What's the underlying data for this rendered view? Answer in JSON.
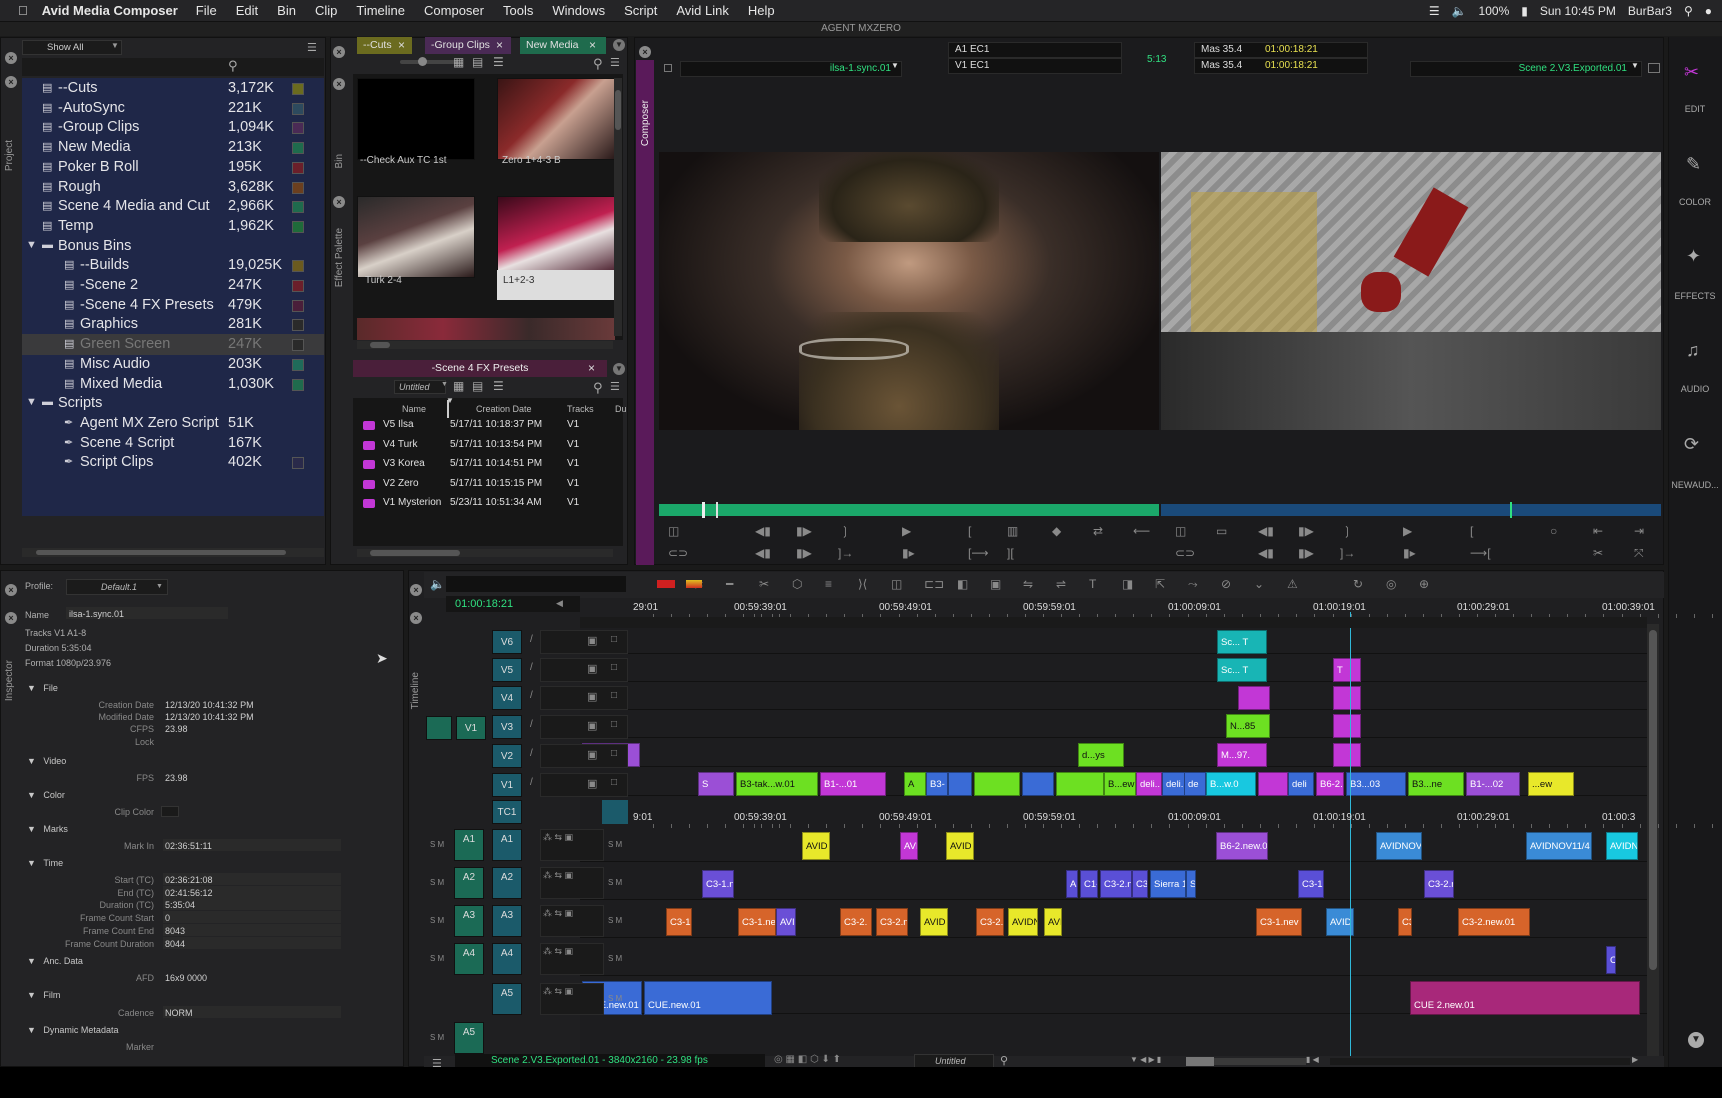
{
  "menubar": {
    "app_name": "Avid Media Composer",
    "items": [
      "File",
      "Edit",
      "Bin",
      "Clip",
      "Timeline",
      "Composer",
      "Tools",
      "Windows",
      "Script",
      "Avid Link",
      "Help"
    ],
    "battery": "100%",
    "clock": "Sun 10:45 PM",
    "user": "BurBar3"
  },
  "window_title": "AGENT MXZERO",
  "project": {
    "filter": "Show All",
    "bins": [
      {
        "name": "--Cuts",
        "size": "3,172K",
        "color": "#6b6b1f",
        "indent": 0,
        "icon": "bin-icon"
      },
      {
        "name": "-AutoSync",
        "size": "221K",
        "color": "#2d4a5e",
        "indent": 0,
        "icon": "bin-icon"
      },
      {
        "name": "-Group Clips",
        "size": "1,094K",
        "color": "#4a2a55",
        "indent": 0,
        "icon": "bin-icon"
      },
      {
        "name": "New Media",
        "size": "213K",
        "color": "#1f6b4d",
        "indent": 0,
        "icon": "bin-icon"
      },
      {
        "name": "Poker B Roll",
        "size": "195K",
        "color": "#6b1f2a",
        "indent": 0,
        "icon": "bin-icon"
      },
      {
        "name": "Rough",
        "size": "3,628K",
        "color": "#6b3f1f",
        "indent": 0,
        "icon": "bin-icon"
      },
      {
        "name": "Scene 4 Media and Cut",
        "size": "2,966K",
        "color": "#1f6b4d",
        "indent": 0,
        "icon": "bin-icon"
      },
      {
        "name": "Temp",
        "size": "1,962K",
        "color": "#1f6b3a",
        "indent": 0,
        "icon": "bin-icon"
      },
      {
        "name": "Bonus Bins",
        "size": "",
        "color": "",
        "indent": 0,
        "icon": "folder-icon",
        "expander": "▼"
      },
      {
        "name": "--Builds",
        "size": "19,025K",
        "color": "#6b5a1f",
        "indent": 1,
        "icon": "bin-icon"
      },
      {
        "name": "-Scene 2",
        "size": "247K",
        "color": "#6b1f2a",
        "indent": 1,
        "icon": "bin-icon"
      },
      {
        "name": "-Scene 4 FX Presets",
        "size": "479K",
        "color": "#4a1f3a",
        "indent": 1,
        "icon": "bin-icon"
      },
      {
        "name": "Graphics",
        "size": "281K",
        "color": "#2a2a2a",
        "indent": 1,
        "icon": "bin-icon"
      },
      {
        "name": "Green Screen",
        "size": "247K",
        "color": "#2a2a2a",
        "indent": 1,
        "icon": "bin-icon",
        "selected": true
      },
      {
        "name": "Misc Audio",
        "size": "203K",
        "color": "#1f6b5a",
        "indent": 1,
        "icon": "bin-icon"
      },
      {
        "name": "Mixed Media",
        "size": "1,030K",
        "color": "#1f6b4d",
        "indent": 1,
        "icon": "bin-icon"
      },
      {
        "name": "Scripts",
        "size": "",
        "color": "",
        "indent": 0,
        "icon": "folder-icon",
        "expander": "▼"
      },
      {
        "name": "Agent MX Zero Script",
        "size": "51K",
        "color": "",
        "indent": 1,
        "icon": "script-icon"
      },
      {
        "name": "Scene 4 Script",
        "size": "167K",
        "color": "",
        "indent": 1,
        "icon": "script-icon"
      },
      {
        "name": "Script Clips",
        "size": "402K",
        "color": "#2a2a4a",
        "indent": 1,
        "icon": "script-icon"
      }
    ]
  },
  "bin_tabs": [
    "--Cuts",
    "-Group Clips",
    "New Media"
  ],
  "bin_thumbs": [
    {
      "label": "--Check Aux TC 1st"
    },
    {
      "label": "Zero 1+4-3 B"
    },
    {
      "label": "Turk 2-4"
    },
    {
      "label": "L1+2-3"
    }
  ],
  "side_tabs": {
    "bin": "Bin",
    "effect_palette": "Effect Palette",
    "project": "Project",
    "composer": "Composer",
    "inspector": "Inspector",
    "timeline": "Timeline"
  },
  "fx_bin": {
    "title": "-Scene 4 FX Presets",
    "view": "Untitled",
    "columns": [
      "Name",
      "Creation Date",
      "Tracks",
      "Du"
    ],
    "rows": [
      {
        "name": "V5 Ilsa",
        "date": "5/17/11 10:18:37 PM",
        "tracks": "V1"
      },
      {
        "name": "V4 Turk",
        "date": "5/17/11 10:13:54 PM",
        "tracks": "V1"
      },
      {
        "name": "V3 Korea",
        "date": "5/17/11 10:14:51 PM",
        "tracks": "V1"
      },
      {
        "name": "V2 Zero",
        "date": "5/17/11 10:15:15 PM",
        "tracks": "V1"
      },
      {
        "name": "V1 Mysterion",
        "date": "5/23/11 10:51:34 AM",
        "tracks": "V1"
      }
    ]
  },
  "composer": {
    "source_clip": "ilsa-1.sync.01",
    "track_a1": "A1  EC1",
    "track_v1": "V1  EC1",
    "duration": "5:13",
    "mas1": "Mas  35.4",
    "tc1": "01:00:18:21",
    "mas2": "Mas  35.4",
    "tc2": "01:00:18:21",
    "record_sequence": "Scene 2.V3.Exported.01"
  },
  "right_panel": [
    "EDIT",
    "COLOR",
    "EFFECTS",
    "AUDIO",
    "NEWAUD..."
  ],
  "inspector": {
    "profile_label": "Profile:",
    "profile": "Default.1",
    "name_label": "Name",
    "name": "ilsa-1.sync.01",
    "tracks": "Tracks   V1 A1-8",
    "duration": "Duration 5:35:04",
    "format": "Format  1080p/23.976",
    "sections": {
      "file": "File",
      "video": "Video",
      "color": "Color",
      "marks": "Marks",
      "time": "Time",
      "anc": "Anc. Data",
      "film": "Film",
      "dynmeta": "Dynamic Metadata"
    },
    "fields": {
      "creation_date": {
        "label": "Creation Date",
        "value": "12/13/20 10:41:32 PM"
      },
      "modified_date": {
        "label": "Modified Date",
        "value": "12/13/20 10:41:32 PM"
      },
      "cfps": {
        "label": "CFPS",
        "value": "23.98"
      },
      "lock": {
        "label": "Lock",
        "value": ""
      },
      "fps": {
        "label": "FPS",
        "value": "23.98"
      },
      "clip_color": {
        "label": "Clip Color",
        "value": ""
      },
      "mark_in": {
        "label": "Mark In",
        "value": "02:36:51:11"
      },
      "start": {
        "label": "Start (TC)",
        "value": "02:36:21:08"
      },
      "end": {
        "label": "End (TC)",
        "value": "02:41:56:12"
      },
      "duration_tc": {
        "label": "Duration (TC)",
        "value": "5:35:04"
      },
      "fcs": {
        "label": "Frame Count Start",
        "value": "0"
      },
      "fce": {
        "label": "Frame Count End",
        "value": "8043"
      },
      "fcd": {
        "label": "Frame Count Duration",
        "value": "8044"
      },
      "afd": {
        "label": "AFD",
        "value": "16x9 0000"
      },
      "cadence": {
        "label": "Cadence",
        "value": "NORM"
      },
      "marker": {
        "label": "Marker",
        "value": ""
      }
    }
  },
  "timeline": {
    "position": "01:00:18:21",
    "ruler": [
      "29:01",
      "00:59:39:01",
      "00:59:49:01",
      "00:59:59:01",
      "01:00:09:01",
      "01:00:19:01",
      "01:00:29:01",
      "01:00:39:01"
    ],
    "ruler2": [
      "9:01",
      "00:59:39:01",
      "00:59:49:01",
      "00:59:59:01",
      "01:00:09:01",
      "01:00:19:01",
      "01:00:29:01",
      "01:00:3"
    ],
    "video_tracks": [
      "V6",
      "V5",
      "V4",
      "V3",
      "V2",
      "V1"
    ],
    "timecode_track": "TC1",
    "source_v": "V1",
    "audio_tracks": [
      "A1",
      "A2",
      "A3",
      "A4",
      "A5"
    ],
    "source_audio": [
      "A1",
      "A2",
      "A3",
      "A4",
      "A5"
    ],
    "status": "Scene 2.V3.Exported.01 - 3840x2160 - 23.98 fps",
    "view": "Untitled",
    "clips": {
      "v6": [
        {
          "t": "Sc... T",
          "c": "#18b5b5"
        }
      ],
      "v5": [
        {
          "t": "Sc... T",
          "c": "#18b5b5"
        },
        {
          "t": "T",
          "c": "#c237d6"
        }
      ],
      "v4": [
        {
          "t": "",
          "c": "#c237d6"
        },
        {
          "t": "",
          "c": "#c237d6"
        }
      ],
      "v3": [
        {
          "t": "N...85",
          "c": "#6de022"
        },
        {
          "t": "",
          "c": "#c237d6"
        }
      ],
      "v2": [
        {
          "t": "...",
          "c": "#9b4fd6"
        },
        {
          "t": "d...ys",
          "c": "#6de022"
        },
        {
          "t": "M...97.",
          "c": "#c237d6"
        },
        {
          "t": "",
          "c": "#c237d6"
        }
      ],
      "v1": [
        {
          "t": "S",
          "c": "#9b4fd6"
        },
        {
          "t": "B3-tak...w.01",
          "c": "#6de022"
        },
        {
          "t": "B1-...01",
          "c": "#c237d6"
        },
        {
          "t": "A",
          "c": "#6de022"
        },
        {
          "t": "B3-",
          "c": "#3a6bd6"
        },
        {
          "t": "",
          "c": "#3a6bd6"
        },
        {
          "t": "",
          "c": "#6de022"
        },
        {
          "t": "",
          "c": "#3a6bd6"
        },
        {
          "t": "",
          "c": "#6de022"
        },
        {
          "t": "B...ew",
          "c": "#6de022"
        },
        {
          "t": "deli...e",
          "c": "#c237d6"
        },
        {
          "t": "deli...",
          "c": "#3a6bd6"
        },
        {
          "t": "de",
          "c": "#3a6bd6"
        },
        {
          "t": "B...w.0",
          "c": "#18c8e0"
        },
        {
          "t": "",
          "c": "#c237d6"
        },
        {
          "t": "deli",
          "c": "#3a6bd6"
        },
        {
          "t": "B6-2.",
          "c": "#c237d6"
        },
        {
          "t": "B3...03",
          "c": "#3a6bd6"
        },
        {
          "t": "B3...ne",
          "c": "#6de022"
        },
        {
          "t": "B1-...02",
          "c": "#9b4fd6"
        },
        {
          "t": "...ew",
          "c": "#e8e82a"
        }
      ],
      "a1": [
        {
          "t": "AVID",
          "c": "#e8e82a"
        },
        {
          "t": "AVI",
          "c": "#c237d6"
        },
        {
          "t": "AVID",
          "c": "#e8e82a"
        },
        {
          "t": "B6-2.new.0",
          "c": "#9b4fd6"
        },
        {
          "t": "AVIDNOV",
          "c": "#3a8bd6"
        },
        {
          "t": "AVIDNOV11/4",
          "c": "#3a8bd6"
        },
        {
          "t": "AVIDN",
          "c": "#18c8e0"
        }
      ],
      "a2": [
        {
          "t": "C3-1.n",
          "c": "#6a4fd6"
        },
        {
          "t": "A",
          "c": "#5a4fd6"
        },
        {
          "t": "C1-2",
          "c": "#5a4fd6"
        },
        {
          "t": "C3-2.n",
          "c": "#5a4fd6"
        },
        {
          "t": "C3",
          "c": "#5a4fd6"
        },
        {
          "t": "Sierra 12",
          "c": "#3a6bd6"
        },
        {
          "t": "Si",
          "c": "#3a6bd6"
        },
        {
          "t": "C3-1.",
          "c": "#5a4fd6"
        },
        {
          "t": "C3-2.n",
          "c": "#6a4fd6"
        }
      ],
      "a3": [
        {
          "t": "C3-1",
          "c": "#d6642a"
        },
        {
          "t": "C3-1.ne",
          "c": "#d6642a"
        },
        {
          "t": "AVII",
          "c": "#6a4fd6"
        },
        {
          "t": "C3-2.",
          "c": "#d6642a"
        },
        {
          "t": "C3-2.n",
          "c": "#d6642a"
        },
        {
          "t": "AVID",
          "c": "#e8e82a"
        },
        {
          "t": "C3-2.",
          "c": "#d6642a"
        },
        {
          "t": "AVIDN",
          "c": "#e8e82a"
        },
        {
          "t": "AVI",
          "c": "#e8e82a"
        },
        {
          "t": "C3-1.nev",
          "c": "#d6642a"
        },
        {
          "t": "AVID",
          "c": "#3a8bd6"
        },
        {
          "t": "C3-",
          "c": "#d6642a"
        },
        {
          "t": "C3-2.new.01",
          "c": "#d6642a"
        }
      ],
      "a4": [
        {
          "t": "Cl",
          "c": "#5a4fd6"
        }
      ],
      "a5": [
        {
          "t": "CUE.new.01",
          "c": "#3a6bd6"
        },
        {
          "t": "CUE.new.01",
          "c": "#3a6bd6"
        },
        {
          "t": "CUE 2.new.01",
          "c": "#a8287a"
        }
      ]
    }
  }
}
